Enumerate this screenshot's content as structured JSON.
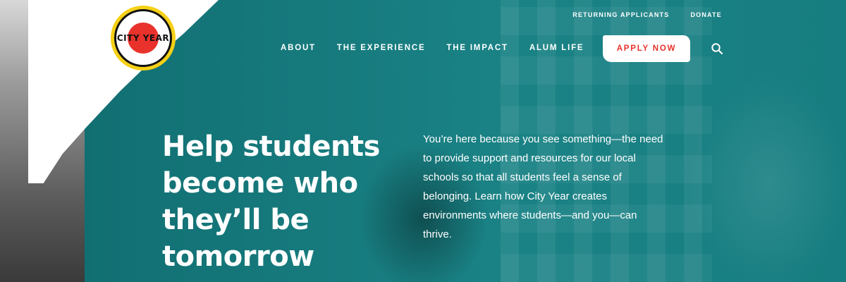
{
  "brand": {
    "logo_text": "CITY YEAR",
    "colors": {
      "teal": "#1a7d80",
      "yellow": "#f6d017",
      "red": "#e8322b",
      "white": "#ffffff"
    }
  },
  "utility_nav": {
    "items": [
      {
        "label": "RETURNING APPLICANTS"
      },
      {
        "label": "DONATE"
      }
    ]
  },
  "main_nav": {
    "items": [
      {
        "label": "ABOUT"
      },
      {
        "label": "THE EXPERIENCE"
      },
      {
        "label": "THE IMPACT"
      },
      {
        "label": "ALUM LIFE"
      }
    ],
    "cta_label": "APPLY NOW",
    "search_icon": "search-icon"
  },
  "hero": {
    "headline": "Help students become who they’ll be tomorrow",
    "body": "You’re here because you see something—the need to provide support and resources for our local schools so that all students feel a sense of belonging. Learn how City Year creates environments where students—and you—can thrive."
  }
}
